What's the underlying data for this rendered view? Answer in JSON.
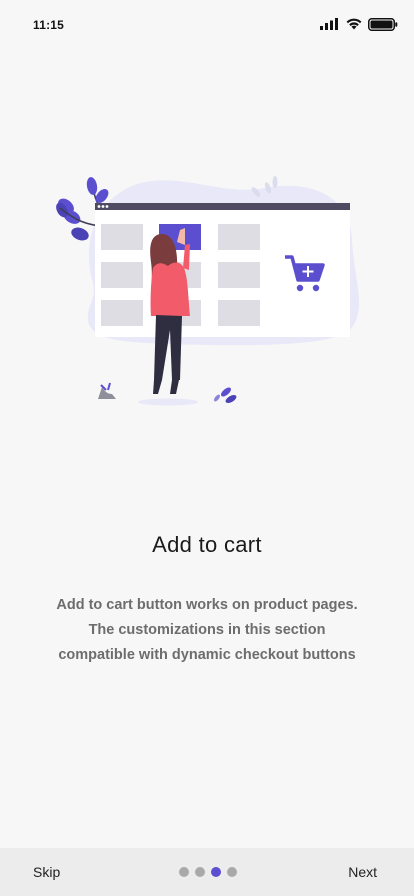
{
  "status_bar": {
    "time": "11:15",
    "icons": [
      "signal-icon",
      "wifi-icon",
      "battery-icon"
    ]
  },
  "onboarding": {
    "illustration": "add-to-cart-illustration",
    "title": "Add to cart",
    "description_lines": [
      "Add to cart button works on product pages.",
      "The customizations in this section",
      "compatible with dynamic checkout buttons"
    ]
  },
  "footer": {
    "skip_label": "Skip",
    "next_label": "Next",
    "page_count": 4,
    "active_page": 3
  },
  "colors": {
    "accent": "#5b4fcf",
    "background": "#f7f7f7",
    "footer_background": "#ececec",
    "dot_inactive": "#a9a9a9"
  }
}
